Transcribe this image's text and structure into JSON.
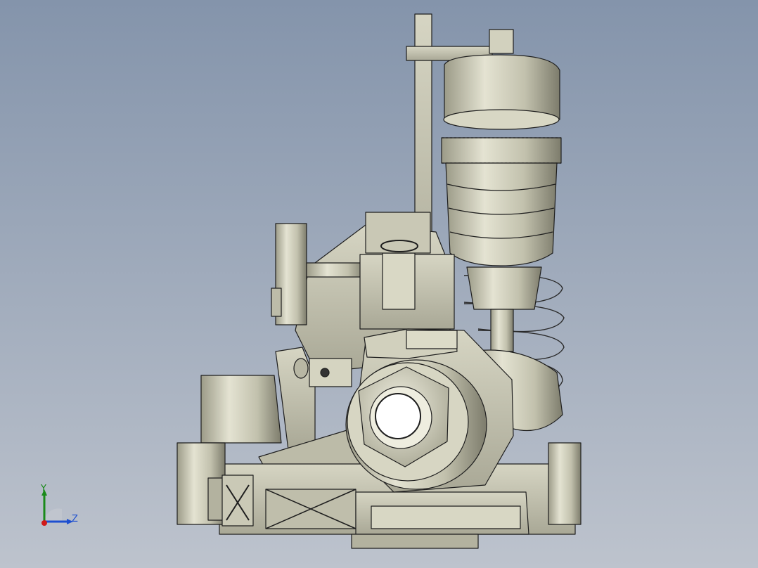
{
  "viewport": {
    "background_top": "#8494ab",
    "background_bottom": "#bdc3cd",
    "model_color": "#c7c6b3",
    "model_edge_color": "#1e1e1e"
  },
  "triad": {
    "y_label": "Y",
    "z_label": "Z",
    "y_color": "#1a8a1a",
    "z_color": "#1d4fd0",
    "x_color": "#d01a1a"
  }
}
